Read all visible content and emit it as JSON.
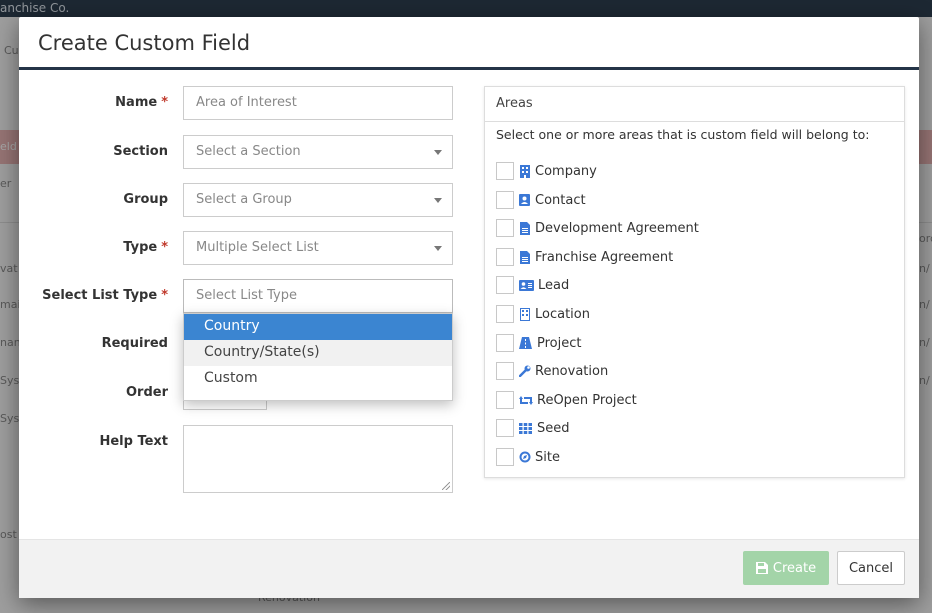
{
  "background": {
    "brand": "anchise Co.",
    "side_fragments": [
      "Cu",
      "eld",
      "er",
      "vat",
      "mai",
      "nan",
      "Sys",
      "Sys",
      "ost"
    ],
    "right_fragments": [
      "orc",
      "n/",
      "n/",
      "n/",
      "n/"
    ],
    "footer_fragment": "Renovation"
  },
  "modal": {
    "title": "Create Custom Field",
    "fields": {
      "name": {
        "label": "Name",
        "required": "*",
        "placeholder": "Area of Interest"
      },
      "section": {
        "label": "Section",
        "value": "Select a Section"
      },
      "group": {
        "label": "Group",
        "value": "Select a Group"
      },
      "type": {
        "label": "Type",
        "required": "*",
        "value": "Multiple Select List"
      },
      "select_list_type": {
        "label": "Select List Type",
        "required": "*",
        "value": "Select List Type"
      },
      "required": {
        "label": "Required"
      },
      "order": {
        "label": "Order"
      },
      "help_text": {
        "label": "Help Text"
      }
    },
    "dropdown": {
      "options": [
        "Country",
        "Country/State(s)",
        "Custom"
      ],
      "highlighted": "Country"
    },
    "areas": {
      "title": "Areas",
      "description": "Select one or more areas that is custom field will belong to:",
      "items": [
        {
          "label": "Company",
          "icon": "building-icon"
        },
        {
          "label": "Contact",
          "icon": "contact-card-icon"
        },
        {
          "label": "Development Agreement",
          "icon": "document-icon"
        },
        {
          "label": "Franchise Agreement",
          "icon": "document-icon"
        },
        {
          "label": "Lead",
          "icon": "id-card-icon"
        },
        {
          "label": "Location",
          "icon": "building-outline-icon"
        },
        {
          "label": "Project",
          "icon": "road-icon"
        },
        {
          "label": "Renovation",
          "icon": "wrench-icon"
        },
        {
          "label": "ReOpen Project",
          "icon": "retweet-icon"
        },
        {
          "label": "Seed",
          "icon": "grid-icon"
        },
        {
          "label": "Site",
          "icon": "compass-icon"
        }
      ]
    },
    "footer": {
      "create_label": "Create",
      "cancel_label": "Cancel"
    }
  },
  "colors": {
    "accent": "#3b85d1",
    "header_rule": "#243447",
    "create_button": "#a3d4a8",
    "required_star": "#c0392b",
    "icon_blue": "#3b78d6"
  }
}
